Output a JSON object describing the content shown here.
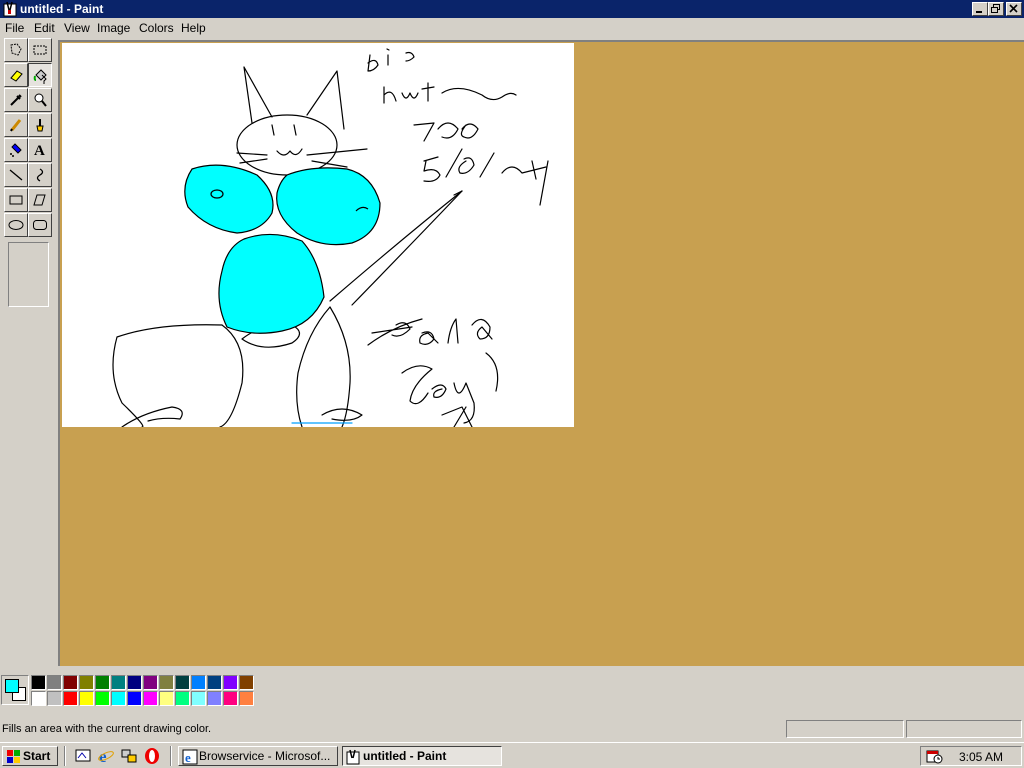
{
  "window": {
    "title": "untitled - Paint",
    "controls": [
      "minimize",
      "restore",
      "close"
    ]
  },
  "menu": [
    "File",
    "Edit",
    "View",
    "Image",
    "Colors",
    "Help"
  ],
  "tools": [
    {
      "name": "free-form-select",
      "icon": "freeform-select-icon"
    },
    {
      "name": "select",
      "icon": "rect-select-icon"
    },
    {
      "name": "eraser",
      "icon": "eraser-icon"
    },
    {
      "name": "fill-with-color",
      "icon": "paint-bucket-icon",
      "active": true
    },
    {
      "name": "pick-color",
      "icon": "eyedropper-icon"
    },
    {
      "name": "magnifier",
      "icon": "magnifier-icon"
    },
    {
      "name": "pencil",
      "icon": "pencil-icon"
    },
    {
      "name": "brush",
      "icon": "brush-icon"
    },
    {
      "name": "airbrush",
      "icon": "airbrush-icon"
    },
    {
      "name": "text",
      "icon": "text-icon"
    },
    {
      "name": "line",
      "icon": "line-icon"
    },
    {
      "name": "curve",
      "icon": "curve-icon"
    },
    {
      "name": "rectangle",
      "icon": "rectangle-icon"
    },
    {
      "name": "polygon",
      "icon": "polygon-icon"
    },
    {
      "name": "ellipse",
      "icon": "ellipse-icon"
    },
    {
      "name": "rounded-rectangle",
      "icon": "rounded-rect-icon"
    }
  ],
  "colors": {
    "foreground": "#00ffff",
    "background": "#ffffff",
    "workspace": "#c8a050",
    "palette_top": [
      "#000000",
      "#808080",
      "#800000",
      "#808000",
      "#008000",
      "#008080",
      "#000080",
      "#800080",
      "#808040",
      "#004040",
      "#0080ff",
      "#004080",
      "#8000ff",
      "#804000"
    ],
    "palette_bottom": [
      "#ffffff",
      "#c0c0c0",
      "#ff0000",
      "#ffff00",
      "#00ff00",
      "#00ffff",
      "#0000ff",
      "#ff00ff",
      "#ffff80",
      "#00ff80",
      "#80ffff",
      "#8080ff",
      "#ff0080",
      "#ff8040"
    ]
  },
  "status": {
    "text": "Fills an area with the current drawing color."
  },
  "taskbar": {
    "start": "Start",
    "quick_launch": [
      "show-desktop-icon",
      "internet-explorer-icon",
      "network-icon",
      "opera-icon"
    ],
    "tasks": [
      {
        "label": "Browservice - Microsof...",
        "icon": "internet-explorer-icon",
        "active": false
      },
      {
        "label": "untitled - Paint",
        "icon": "paint-icon",
        "active": true
      }
    ],
    "clock": "3:05 AM"
  }
}
